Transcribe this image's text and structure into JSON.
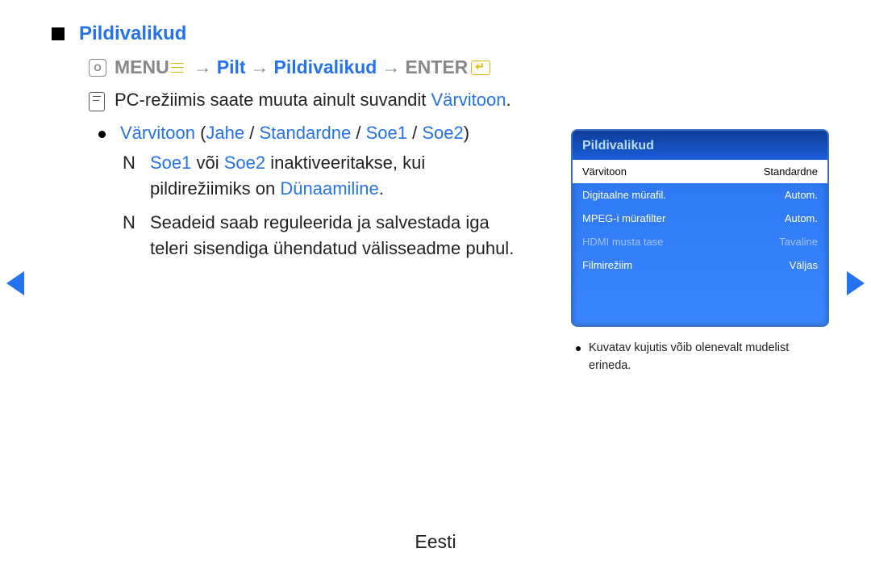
{
  "heading": "Pildivalikud",
  "path": {
    "menu": "MENU",
    "seg1": "Pilt",
    "seg2": "Pildivalikud",
    "enter": "ENTER"
  },
  "note": {
    "prefix": "PC-režiimis saate muuta ainult suvandit ",
    "hl": "Värvitoon",
    "suffix": "."
  },
  "option": {
    "name": "Värvitoon",
    "open": " (",
    "v1": "Jahe",
    "sep": " / ",
    "v2": "Standardne",
    "v3": "Soe1",
    "v4": "Soe2",
    "close": ")"
  },
  "sub1": {
    "a": "Soe1",
    "mid": " või ",
    "b": "Soe2",
    "rest1": " inaktiveeritakse, kui pildirežiimiks on ",
    "c": "Dünaamiline",
    "dot": "."
  },
  "sub2": "Seadeid saab reguleerida ja salvestada iga teleri sisendiga ühendatud välisseadme puhul.",
  "panel": {
    "title": "Pildivalikud",
    "rows": [
      {
        "label": "Värvitoon",
        "value": "Standardne",
        "state": "selected"
      },
      {
        "label": "Digitaalne mürafil.",
        "value": "Autom.",
        "state": "normal"
      },
      {
        "label": "MPEG-i mürafilter",
        "value": "Autom.",
        "state": "normal"
      },
      {
        "label": "HDMI musta tase",
        "value": "Tavaline",
        "state": "dim"
      },
      {
        "label": "Filmirežiim",
        "value": "Väljas",
        "state": "normal"
      }
    ],
    "note": "Kuvatav kujutis võib olenevalt mudelist erineda."
  },
  "footer": "Eesti"
}
